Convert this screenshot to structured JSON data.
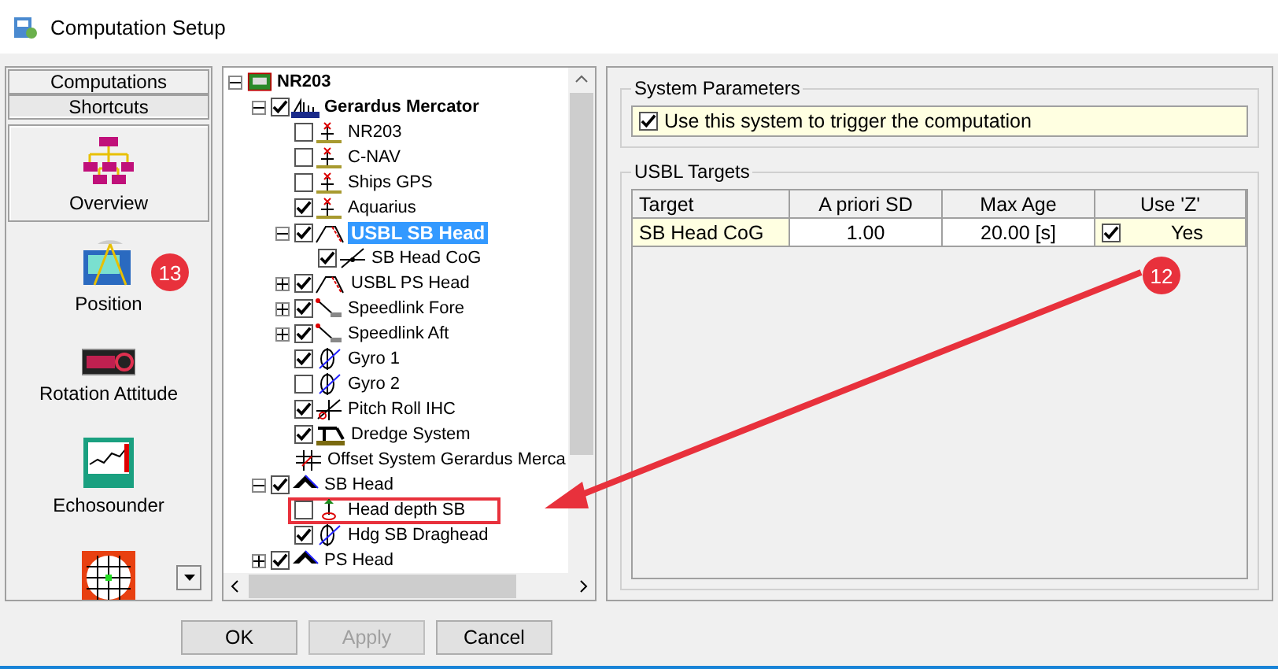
{
  "window": {
    "title": "Computation Setup"
  },
  "sidebar": {
    "tabs": [
      {
        "label": "Computations",
        "selected": false
      },
      {
        "label": "Shortcuts",
        "selected": true
      }
    ],
    "items": [
      {
        "label": "Overview",
        "kind": "overview",
        "selected": true
      },
      {
        "label": "Position",
        "kind": "position",
        "selected": false
      },
      {
        "label": "Rotation Attitude",
        "kind": "rotation",
        "selected": false
      },
      {
        "label": "Echosounder",
        "kind": "echosounder",
        "selected": false
      },
      {
        "kind": "model",
        "selected": false
      }
    ]
  },
  "tree": {
    "items": [
      {
        "label": "NR203",
        "kind": "network",
        "bold": true,
        "expanded": true,
        "children": [
          {
            "label": "Gerardus Mercator",
            "kind": "vessel",
            "bold": true,
            "checked": true,
            "expanded": true,
            "children": [
              {
                "label": "NR203",
                "kind": "antenna",
                "checked": false
              },
              {
                "label": "C-NAV",
                "kind": "antenna",
                "checked": false
              },
              {
                "label": "Ships GPS",
                "kind": "antenna",
                "checked": false
              },
              {
                "label": "Aquarius",
                "kind": "antenna",
                "checked": true
              },
              {
                "label": "USBL SB Head",
                "kind": "usbl",
                "checked": true,
                "expanded": true,
                "selected": true,
                "children": [
                  {
                    "label": "SB Head CoG",
                    "kind": "target",
                    "checked": true
                  }
                ]
              },
              {
                "label": "USBL PS Head",
                "kind": "usbl",
                "checked": true,
                "expanded": false
              },
              {
                "label": "Speedlink Fore",
                "kind": "speedlink",
                "checked": true,
                "expanded": false
              },
              {
                "label": "Speedlink Aft",
                "kind": "speedlink",
                "checked": true,
                "expanded": false
              },
              {
                "label": "Gyro 1",
                "kind": "gyro",
                "checked": true
              },
              {
                "label": "Gyro 2",
                "kind": "gyro",
                "checked": false
              },
              {
                "label": "Pitch Roll IHC",
                "kind": "pitch",
                "checked": true
              },
              {
                "label": "Dredge System",
                "kind": "dredge",
                "checked": true
              },
              {
                "label": "Offset System Gerardus Merca",
                "kind": "offset"
              }
            ]
          },
          {
            "label": "SB Head",
            "kind": "head",
            "checked": true,
            "expanded": true,
            "children": [
              {
                "label": "Head depth SB",
                "kind": "depth",
                "checked": false,
                "highlighted": true
              },
              {
                "label": "Hdg SB Draghead",
                "kind": "gyro",
                "checked": true
              }
            ]
          },
          {
            "label": "PS Head",
            "kind": "head",
            "checked": true,
            "expanded": false
          }
        ]
      }
    ]
  },
  "system_parameters": {
    "title": "System Parameters",
    "trigger": {
      "label": "Use this system to trigger the computation",
      "checked": true
    }
  },
  "usbl_targets": {
    "title": "USBL Targets",
    "columns": [
      "Target",
      "A priori SD",
      "Max Age",
      "Use 'Z'"
    ],
    "rows": [
      {
        "target": "SB Head CoG",
        "sd": "1.00",
        "max_age": "20.00 [s]",
        "use_z": {
          "label": "Yes",
          "checked": true
        }
      }
    ]
  },
  "buttons": [
    {
      "label": "OK",
      "disabled": false
    },
    {
      "label": "Apply",
      "disabled": true
    },
    {
      "label": "Cancel",
      "disabled": false
    }
  ],
  "annotations": {
    "badges": [
      "13",
      "12"
    ]
  }
}
